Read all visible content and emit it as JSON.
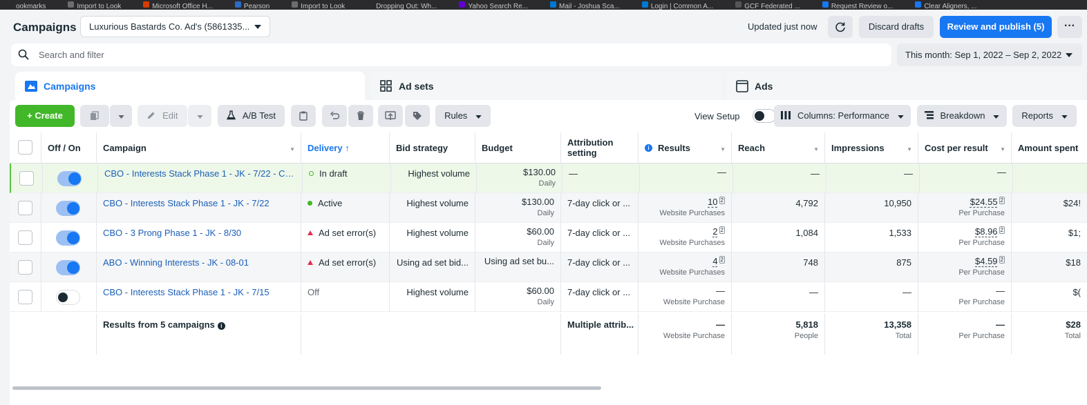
{
  "browser": {
    "bookmarks": [
      {
        "label": "ookmarks",
        "color": "#2b2b2d"
      },
      {
        "label": "Import to Look",
        "color": "#6d6d6d"
      },
      {
        "label": "Microsoft Office H...",
        "color": "#d83b01"
      },
      {
        "label": "Pearson",
        "color": "#2b6cc4"
      },
      {
        "label": "Import to Look",
        "color": "#6d6d6d"
      },
      {
        "label": "Dropping Out: Wh...",
        "color": "#2b2b2d"
      },
      {
        "label": "Yahoo Search Re...",
        "color": "#6001d2"
      },
      {
        "label": "Mail - Joshua Sca...",
        "color": "#0078d4"
      },
      {
        "label": "Login | Common A...",
        "color": "#0078d4"
      },
      {
        "label": "GCF Federated ...",
        "color": "#555555"
      },
      {
        "label": "Request Review o...",
        "color": "#1877f2"
      },
      {
        "label": "Clear Aligners, ...",
        "color": "#1877f2"
      }
    ]
  },
  "header": {
    "title": "Campaigns",
    "account": "Luxurious Bastards Co. Ad's (5861335...",
    "updated": "Updated just now",
    "discard_label": "Discard drafts",
    "publish_label": "Review and publish (5)",
    "more_label": "···"
  },
  "search": {
    "placeholder": "Search and filter",
    "date_range": "This month: Sep 1, 2022 – Sep 2, 2022"
  },
  "tabs": [
    {
      "label": "Campaigns",
      "active": true
    },
    {
      "label": "Ad sets",
      "active": false
    },
    {
      "label": "Ads",
      "active": false
    }
  ],
  "toolbar": {
    "create": "+ Create",
    "edit": "Edit",
    "ab_test": "A/B Test",
    "rules": "Rules",
    "view_setup": "View Setup",
    "columns": "Columns: Performance",
    "breakdown": "Breakdown",
    "reports": "Reports"
  },
  "table": {
    "columns": [
      "Off / On",
      "Campaign",
      "Delivery ↑",
      "Bid strategy",
      "Budget",
      "Attribution setting",
      "Results",
      "Reach",
      "Impressions",
      "Cost per result",
      "Amount spent"
    ],
    "rows": [
      {
        "on": true,
        "campaign": "CBO - Interests Stack Phase 1 - JK - 7/22 - Co...",
        "delivery": "In draft",
        "status": "draft",
        "bid": "Highest volume",
        "budget": "$130.00",
        "budget_sub": "Daily",
        "attribution": "—",
        "results": "—",
        "results_sub": "",
        "reach": "—",
        "impressions": "—",
        "cpr": "—",
        "cpr_sub": "",
        "spent": ""
      },
      {
        "on": true,
        "campaign": "CBO - Interests Stack Phase 1 - JK - 7/22",
        "delivery": "Active",
        "status": "active",
        "bid": "Highest volume",
        "budget": "$130.00",
        "budget_sub": "Daily",
        "attribution": "7-day click or ...",
        "results": "10",
        "results_sub": "Website Purchases",
        "reach": "4,792",
        "impressions": "10,950",
        "cpr": "$24.55",
        "cpr_sub": "Per Purchase",
        "spent": "$24!"
      },
      {
        "on": true,
        "campaign": "CBO - 3 Prong Phase 1 - JK - 8/30",
        "delivery": "Ad set error(s)",
        "status": "error",
        "bid": "Highest volume",
        "budget": "$60.00",
        "budget_sub": "Daily",
        "attribution": "7-day click or ...",
        "results": "2",
        "results_sub": "Website Purchases",
        "reach": "1,084",
        "impressions": "1,533",
        "cpr": "$8.96",
        "cpr_sub": "Per Purchase",
        "spent": "$1;"
      },
      {
        "on": true,
        "campaign": "ABO - Winning Interests - JK - 08-01",
        "delivery": "Ad set error(s)",
        "status": "error",
        "bid": "Using ad set bid...",
        "budget": "Using ad set bu...",
        "budget_sub": "",
        "attribution": "7-day click or ...",
        "results": "4",
        "results_sub": "Website Purchases",
        "reach": "748",
        "impressions": "875",
        "cpr": "$4.59",
        "cpr_sub": "Per Purchase",
        "spent": "$18"
      },
      {
        "on": false,
        "campaign": "CBO - Interests Stack Phase 1 - JK - 7/15",
        "delivery": "Off",
        "status": "off",
        "bid": "Highest volume",
        "budget": "$60.00",
        "budget_sub": "Daily",
        "attribution": "7-day click or ...",
        "results": "—",
        "results_sub": "Website Purchase",
        "reach": "—",
        "impressions": "—",
        "cpr": "—",
        "cpr_sub": "Per Purchase",
        "spent": "$("
      }
    ],
    "totals": {
      "label": "Results from 5 campaigns",
      "attribution": "Multiple attrib...",
      "results": "—",
      "results_sub": "Website Purchase",
      "reach": "5,818",
      "reach_sub": "People",
      "impressions": "13,358",
      "impressions_sub": "Total",
      "cpr": "—",
      "cpr_sub": "Per Purchase",
      "spent": "$28",
      "spent_sub": "Total"
    }
  },
  "colors": {
    "accent": "#1877f2",
    "create": "#42b72a",
    "error": "#e0304e",
    "draft_row": "#eef8e9"
  }
}
